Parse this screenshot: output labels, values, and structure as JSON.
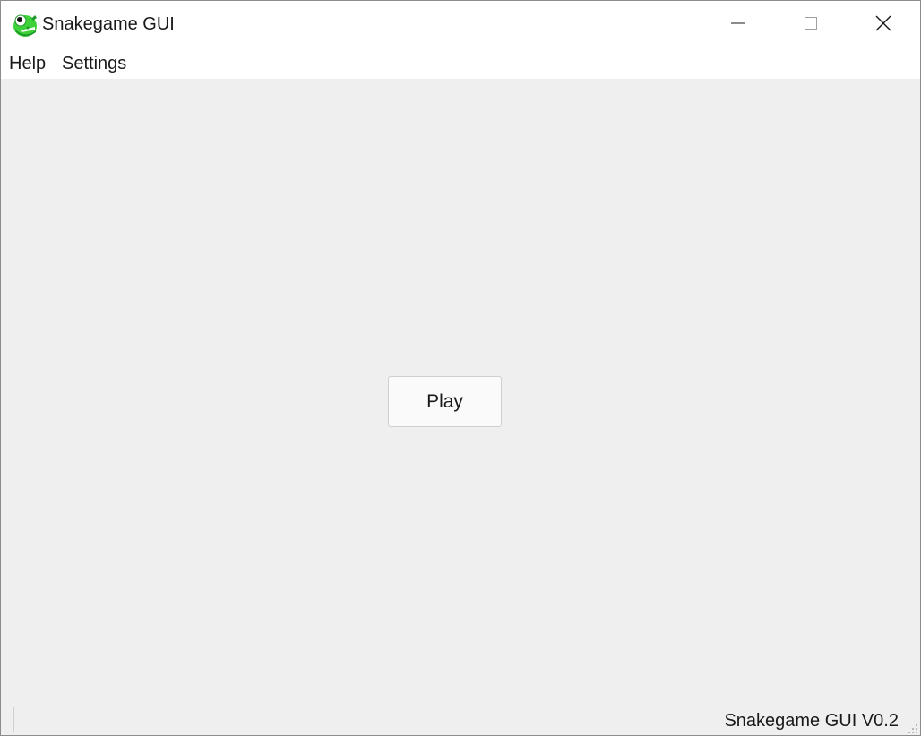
{
  "window": {
    "title": "Snakegame GUI",
    "icon": "snake-head-icon",
    "caption_buttons": [
      "minimize-icon",
      "maximize-icon",
      "close-icon"
    ]
  },
  "menu": {
    "items": [
      {
        "label": "Help"
      },
      {
        "label": "Settings"
      }
    ]
  },
  "main": {
    "play_label": "Play"
  },
  "status": {
    "version": "Snakegame GUI V0.2"
  },
  "colors": {
    "background": "#efefef",
    "titlebar": "#ffffff",
    "button": "#fafafa",
    "icon_green": "#3fd13a"
  }
}
